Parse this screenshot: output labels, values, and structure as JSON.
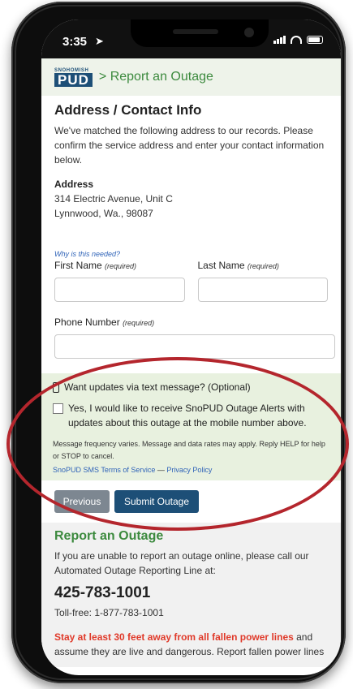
{
  "status_bar": {
    "time": "3:35",
    "location_icon": "location-arrow-icon"
  },
  "header": {
    "logo_small": "SNOHOMISH",
    "logo_big": "PUD",
    "title": "> Report an Outage"
  },
  "form": {
    "heading": "Address / Contact Info",
    "intro": "We've matched the following address to our records. Please confirm the service address and enter your contact information below.",
    "address_label": "Address",
    "address_line1": "314 Electric Avenue, Unit C",
    "address_line2": "Lynnwood, Wa., 98087",
    "why_link": "Why is this needed?",
    "first_name_label": "First Name",
    "last_name_label": "Last Name",
    "phone_label": "Phone Number",
    "required_tag": "(required)",
    "first_name_value": "",
    "last_name_value": "",
    "phone_value": ""
  },
  "sms": {
    "question": "Want updates via text message? (Optional)",
    "optin_text": "Yes, I would like to receive SnoPUD Outage Alerts with updates about this outage at the mobile number above.",
    "fine_print": "Message frequency varies. Message and data rates may apply. Reply HELP for help or STOP to cancel.",
    "terms_link": "SnoPUD SMS Terms of Service",
    "separator": "—",
    "privacy_link": "Privacy Policy",
    "optin_checked": false
  },
  "buttons": {
    "previous": "Previous",
    "submit": "Submit Outage"
  },
  "report": {
    "heading": "Report an Outage",
    "text": "If you are unable to report an outage online, please call our Automated Outage Reporting Line at:",
    "phone": "425-783-1001",
    "tollfree": "Toll-free: 1-877-783-1001",
    "warning_bold": "Stay at least 30 feet away from all fallen power lines",
    "warning_rest": " and assume they are live and dangerous. Report fallen power lines"
  },
  "colors": {
    "brand_blue": "#1d4f77",
    "brand_green": "#3c8a3e",
    "sms_bg": "#e8f1df",
    "annotation_red": "#b4262d",
    "warning_red": "#e03a2a"
  }
}
